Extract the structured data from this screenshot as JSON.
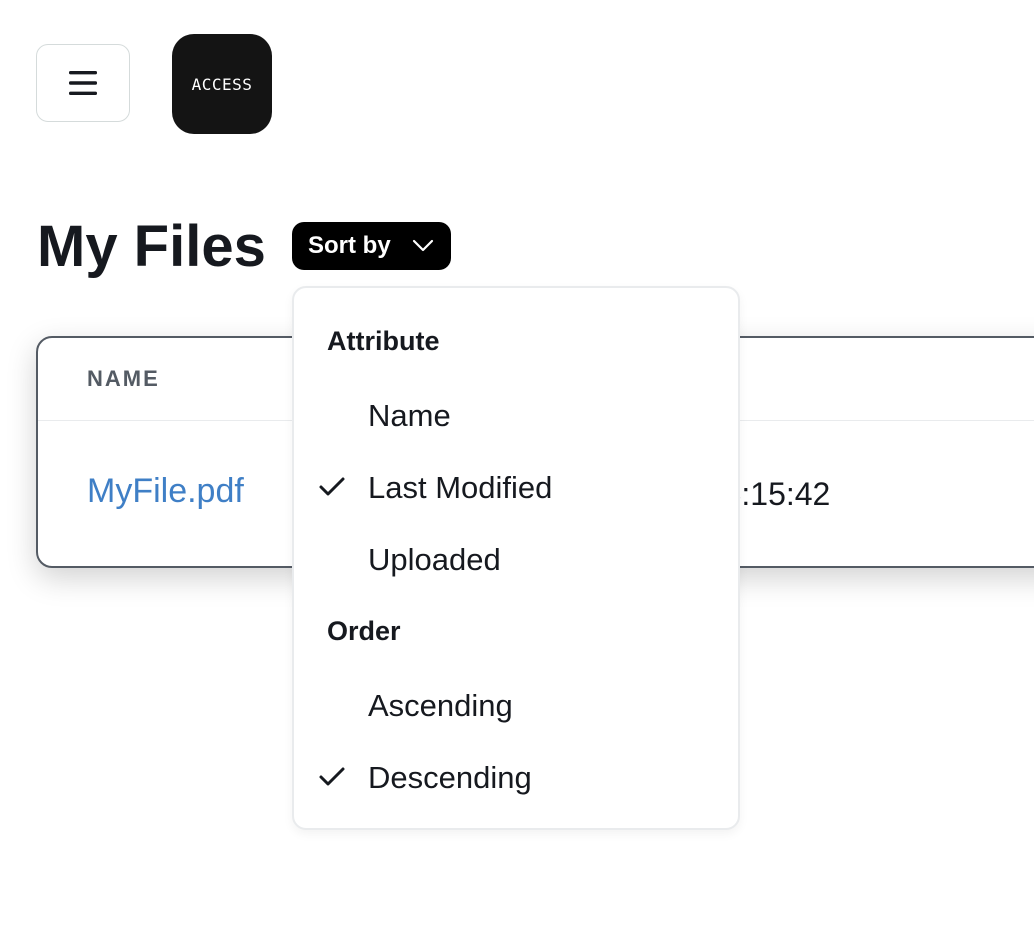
{
  "header": {
    "menu_icon": "hamburger-icon",
    "logo_text": "ACCESS"
  },
  "page": {
    "title": "My Files",
    "sort_button_label": "Sort by",
    "sort_button_icon": "chevron-down-icon"
  },
  "table": {
    "columns": [
      "NAME"
    ],
    "rows": [
      {
        "name": "MyFile.pdf",
        "modified_visible": "…, 15:15:42"
      }
    ]
  },
  "sort_menu": {
    "groups": [
      {
        "label": "Attribute",
        "options": [
          {
            "label": "Name",
            "checked": false
          },
          {
            "label": "Last Modified",
            "checked": true
          },
          {
            "label": "Uploaded",
            "checked": false
          }
        ]
      },
      {
        "label": "Order",
        "options": [
          {
            "label": "Ascending",
            "checked": false
          },
          {
            "label": "Descending",
            "checked": true
          }
        ]
      }
    ],
    "check_icon": "checkmark-icon"
  },
  "colors": {
    "link": "#3f7fc6",
    "text": "#16191f",
    "header_text": "#545b64",
    "button_bg": "#000000",
    "logo_bg": "#141414"
  }
}
